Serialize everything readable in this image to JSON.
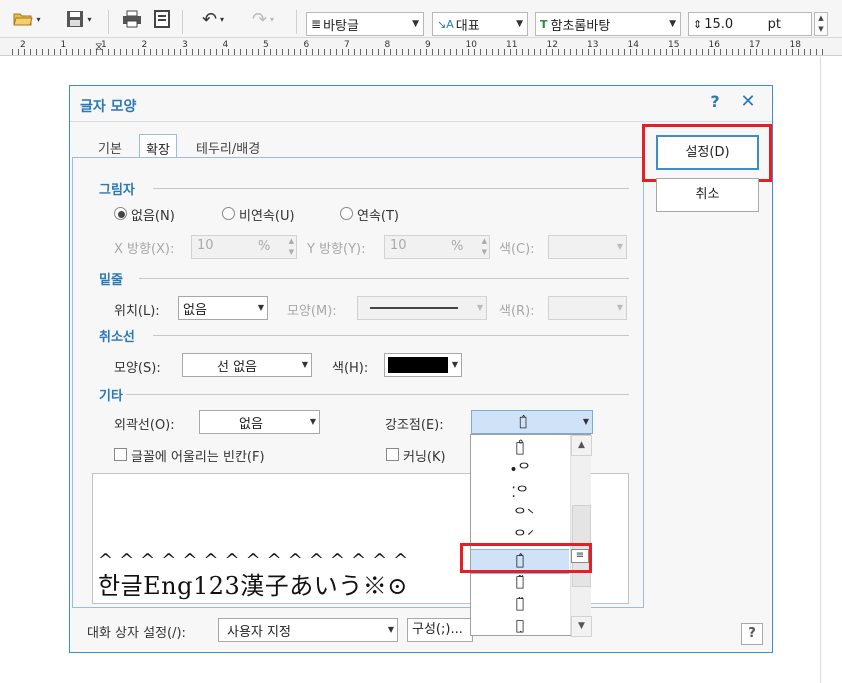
{
  "toolbar": {
    "style_combo": "바탕글",
    "lang_combo": "대표",
    "font_combo": "함초롬바탕",
    "size_value": "15.0",
    "size_unit": "pt"
  },
  "ruler": {
    "numbers": [
      "2",
      "1",
      "1",
      "2",
      "3",
      "4",
      "5",
      "6",
      "7",
      "8",
      "9",
      "10",
      "11",
      "12",
      "13",
      "14",
      "15",
      "16",
      "17",
      "18"
    ]
  },
  "dialog": {
    "title": "글자 모양",
    "help": "?",
    "close": "✕",
    "tabs": [
      "기본",
      "확장",
      "테두리/배경"
    ],
    "active_tab": "확장",
    "ok_button": "설정(D)",
    "cancel_button": "취소",
    "shadow": {
      "heading": "그림자",
      "options": [
        "없음(N)",
        "비연속(U)",
        "연속(T)"
      ],
      "selected": "없음(N)",
      "x_label": "X 방향(X):",
      "x_value": "10",
      "x_unit": "%",
      "y_label": "Y 방향(Y):",
      "y_value": "10",
      "y_unit": "%",
      "color_label": "색(C):"
    },
    "underline": {
      "heading": "밑줄",
      "position_label": "위치(L):",
      "position_value": "없음",
      "shape_label": "모양(M):",
      "color_label": "색(R):"
    },
    "strike": {
      "heading": "취소선",
      "shape_label": "모양(S):",
      "shape_value": "선 없음",
      "color_label": "색(H):",
      "color_value": "#000000"
    },
    "etc": {
      "heading": "기타",
      "outline_label": "외곽선(O):",
      "outline_value": "없음",
      "emphasis_label": "강조점(E):",
      "emphasis_value": "ᄋ̂",
      "fit_space_label": "글꼴에 어울리는 빈칸(F)",
      "kerning_label": "커닝(K)"
    },
    "emphasis_options": [
      "ᄋ̊",
      "•ᄋ",
      "⁚ᄋ",
      "ᄋ̀",
      "ᄋ́",
      "ᄋ̂",
      "ᄋ̃",
      "ᄋ̈",
      "ᄋ̣"
    ],
    "emphasis_selected_index": 5,
    "preview_text": "한글Eng123漢子あいう※⊙",
    "preview_accents": "^^^^^^^^^^^^^^^",
    "footer": {
      "setting_label": "대화 상자 설정(/):",
      "setting_value": "사용자 지정",
      "config_button": "구성(;)...",
      "help_button": "?"
    }
  }
}
